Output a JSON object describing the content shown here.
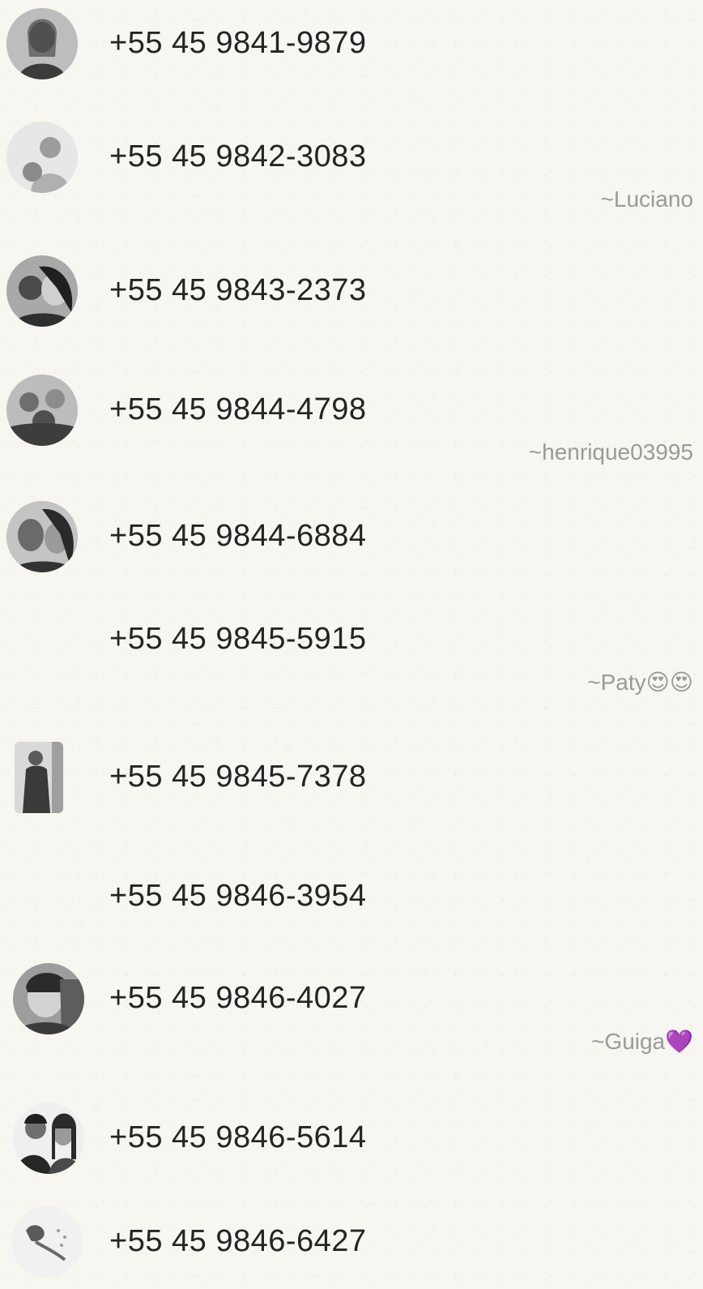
{
  "contacts": [
    {
      "phone": "+55 45 9841-9879",
      "nickname": "",
      "avatar": "photo"
    },
    {
      "phone": "+55 45 9842-3083",
      "nickname": "~Luciano",
      "avatar": "photo"
    },
    {
      "phone": "+55 45 9843-2373",
      "nickname": "",
      "avatar": "photo"
    },
    {
      "phone": "+55 45 9844-4798",
      "nickname": "~henrique03995",
      "avatar": "photo"
    },
    {
      "phone": "+55 45 9844-6884",
      "nickname": "",
      "avatar": "photo"
    },
    {
      "phone": "+55 45 9845-5915",
      "nickname": "~Paty😍😍",
      "avatar": "none"
    },
    {
      "phone": "+55 45 9845-7378",
      "nickname": "",
      "avatar": "photo"
    },
    {
      "phone": "+55 45 9846-3954",
      "nickname": "",
      "avatar": "none"
    },
    {
      "phone": "+55 45 9846-4027",
      "nickname": "~Guiga💜",
      "avatar": "photo"
    },
    {
      "phone": "+55 45 9846-5614",
      "nickname": "",
      "avatar": "photo"
    },
    {
      "phone": "+55 45 9846-6427",
      "nickname": "",
      "avatar": "photo"
    }
  ]
}
